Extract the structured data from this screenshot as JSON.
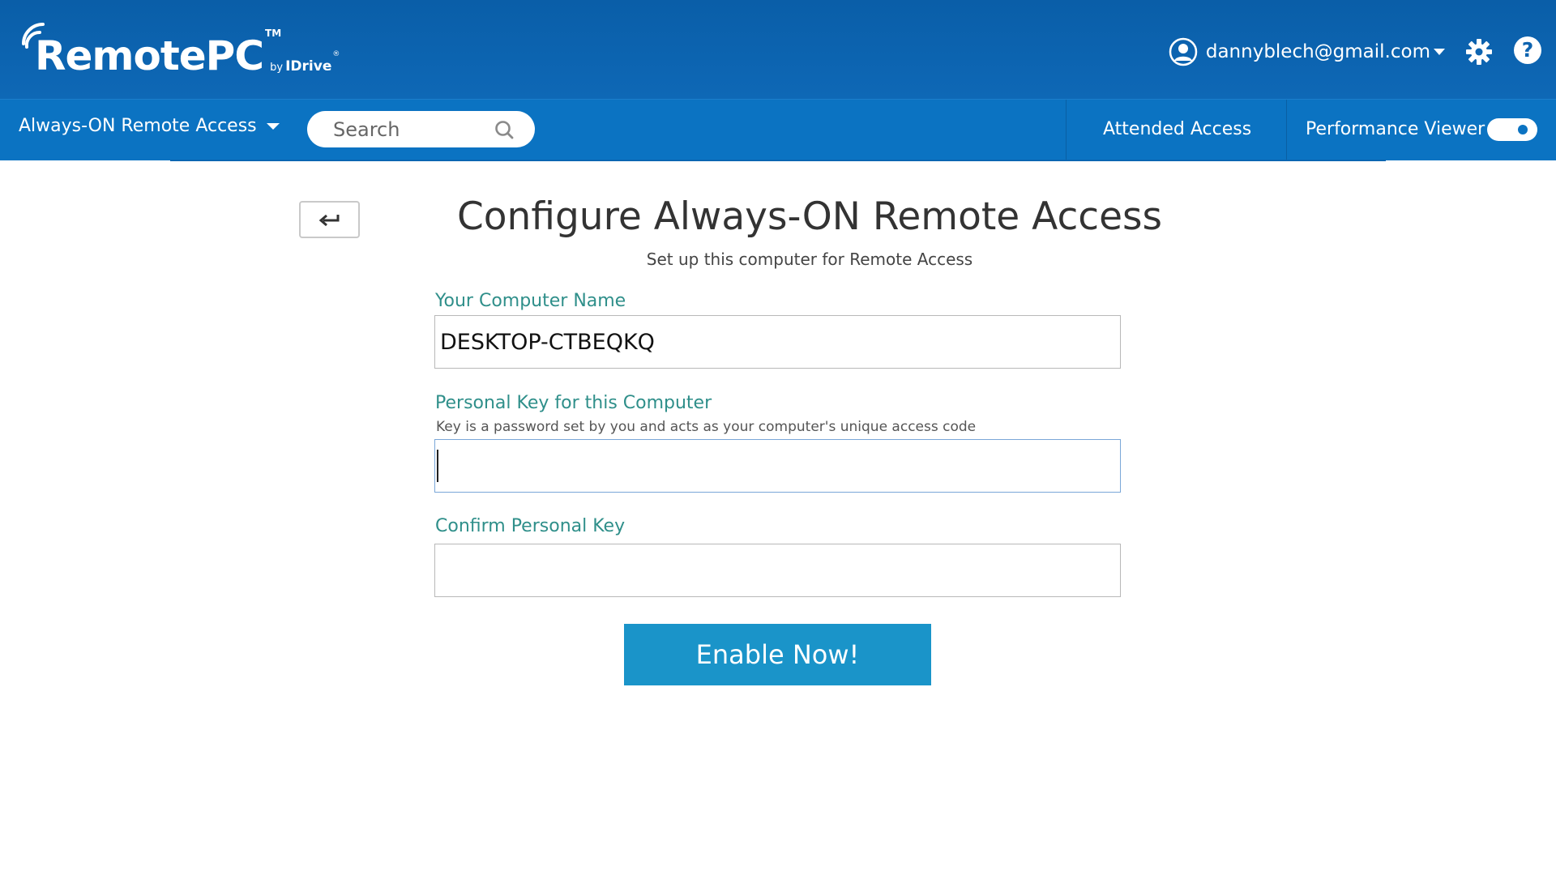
{
  "header": {
    "logo": {
      "name": "RemotePC",
      "tm": "TM",
      "by": "by",
      "brand": "IDrive",
      "reg": "®"
    },
    "account_email": "dannyblech@gmail.com",
    "icons": [
      "user-icon",
      "chevron-down-icon",
      "gear-icon",
      "help-icon"
    ],
    "help_glyph": "?"
  },
  "nav": {
    "dropdown_label": "Always-ON Remote Access",
    "search_placeholder": "Search",
    "attended_access": "Attended Access",
    "performance_viewer": "Performance Viewer",
    "performance_viewer_enabled": true
  },
  "main": {
    "title": "Configure Always-ON Remote Access",
    "subtitle": "Set up this computer for Remote Access",
    "computer_name_label": "Your Computer Name",
    "computer_name_value": "DESKTOP-CTBEQKQ",
    "personal_key_label": "Personal Key for this Computer",
    "personal_key_help": "Key is a password set by you and acts as your computer's unique access code",
    "personal_key_value": "",
    "confirm_key_label": "Confirm Personal Key",
    "confirm_key_value": "",
    "enable_button": "Enable Now!"
  },
  "colors": {
    "header_bg": "#0e64b0",
    "nav_bg": "#0b73c2",
    "label_teal": "#2f8f8a",
    "button_blue": "#1a94c9"
  }
}
